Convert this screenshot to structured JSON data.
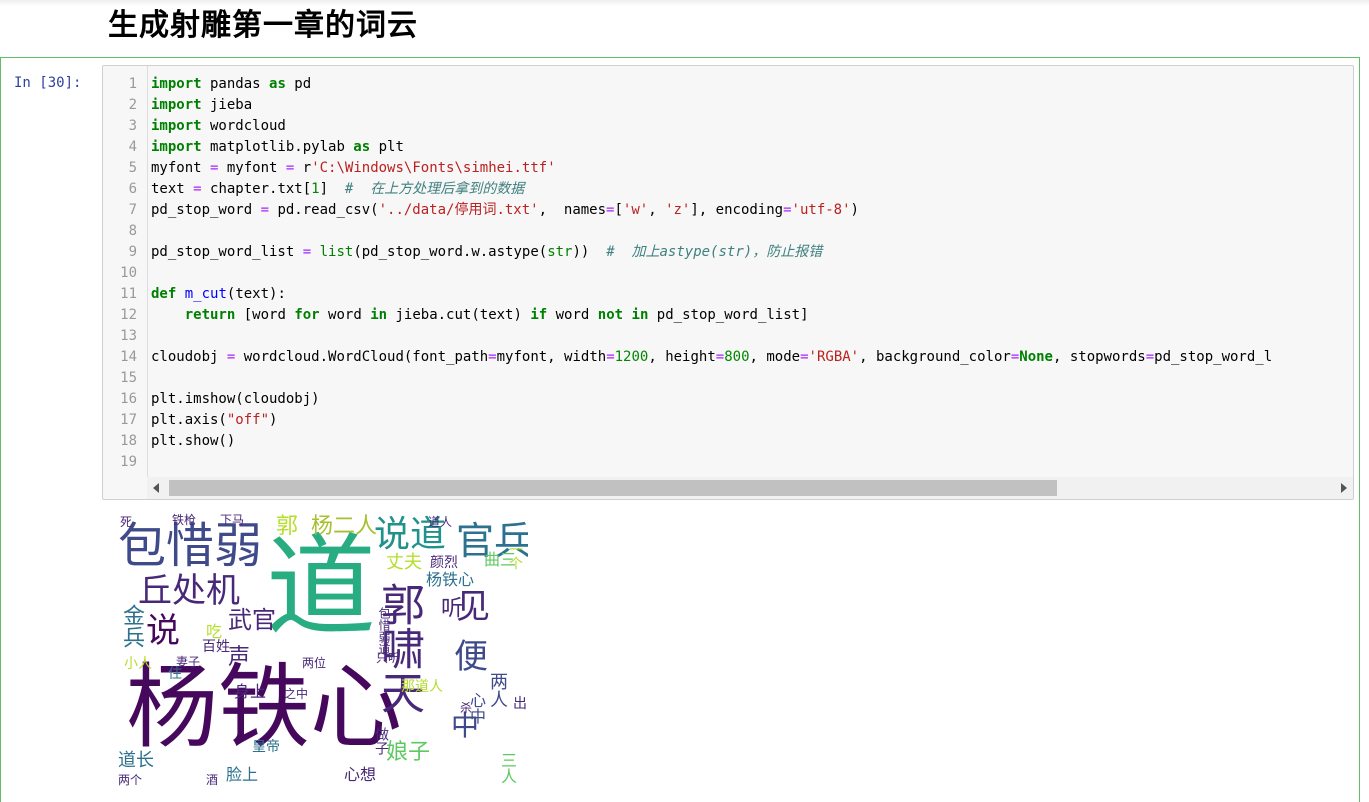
{
  "heading": "生成射雕第一章的词云",
  "cell": {
    "prompt": "In  [30]:",
    "line_numbers": [
      "1",
      "2",
      "3",
      "4",
      "5",
      "6",
      "7",
      "8",
      "9",
      "10",
      "11",
      "12",
      "13",
      "14",
      "15",
      "16",
      "17",
      "18",
      "19"
    ],
    "code_lines": [
      "import pandas as pd",
      "import jieba",
      "import wordcloud",
      "import matplotlib.pylab as plt",
      "myfont = myfont = r'C:\\Windows\\Fonts\\simhei.ttf'",
      "text = chapter.txt[1]  #  在上方处理后拿到的数据",
      "pd_stop_word = pd.read_csv('../data/停用词.txt',  names=['w', 'z'], encoding='utf-8')",
      "",
      "pd_stop_word_list = list(pd_stop_word.w.astype(str))  #  加上astype(str)，防止报错",
      "",
      "def m_cut(text):",
      "    return [word for word in jieba.cut(text) if word not in pd_stop_word_list]",
      "",
      "cloudobj = wordcloud.WordCloud(font_path=myfont, width=1200, height=800, mode='RGBA', background_color=None, stopwords=pd_stop_word_l",
      "",
      "plt.imshow(cloudobj)",
      "plt.axis(\"off\")",
      "plt.show()",
      ""
    ]
  },
  "wordcloud": {
    "colors": {
      "dark": "#46085c",
      "purple": "#482878",
      "blue": "#3e4a89",
      "teal": "#2c728e",
      "cyan": "#21918c",
      "green": "#27ad81",
      "lime": "#5ec962",
      "yellow": "#b5de2b",
      "olive": "#a8c030"
    },
    "words": [
      {
        "text": "杨铁心",
        "color": "dark"
      },
      {
        "text": "道",
        "color": "green"
      },
      {
        "text": "包惜弱",
        "color": "blue"
      },
      {
        "text": "郭啸天",
        "color": "purple"
      },
      {
        "text": "说道",
        "color": "cyan"
      },
      {
        "text": "官兵",
        "color": "teal"
      },
      {
        "text": "丘处机",
        "color": "purple"
      },
      {
        "text": "说",
        "color": "dark"
      },
      {
        "text": "武官",
        "color": "purple"
      },
      {
        "text": "见",
        "color": "purple"
      },
      {
        "text": "便",
        "color": "blue"
      },
      {
        "text": "听",
        "color": "purple"
      },
      {
        "text": "金兵",
        "color": "teal"
      },
      {
        "text": "杨二人",
        "color": "olive"
      },
      {
        "text": "郭",
        "color": "yellow"
      },
      {
        "text": "丈夫",
        "color": "yellow"
      },
      {
        "text": "娘子",
        "color": "lime"
      },
      {
        "text": "中",
        "color": "blue"
      },
      {
        "text": "两人",
        "color": "blue"
      },
      {
        "text": "杨铁心",
        "color": "teal"
      },
      {
        "text": "颜烈",
        "color": "purple"
      },
      {
        "text": "声",
        "color": "purple"
      },
      {
        "text": "身上",
        "color": "purple"
      },
      {
        "text": "吃",
        "color": "yellow"
      },
      {
        "text": "百姓",
        "color": "purple"
      },
      {
        "text": "心想",
        "color": "purple"
      },
      {
        "text": "道长",
        "color": "teal"
      },
      {
        "text": "小人",
        "color": "yellow"
      },
      {
        "text": "三人",
        "color": "lime"
      },
      {
        "text": "那道人",
        "color": "yellow"
      },
      {
        "text": "做子",
        "color": "purple"
      },
      {
        "text": "心中",
        "color": "blue"
      },
      {
        "text": "脸上",
        "color": "teal"
      },
      {
        "text": "皇帝",
        "color": "teal"
      },
      {
        "text": "两位",
        "color": "purple"
      },
      {
        "text": "出",
        "color": "purple"
      },
      {
        "text": "之中",
        "color": "purple"
      },
      {
        "text": "铁枪",
        "color": "purple"
      },
      {
        "text": "下马",
        "color": "purple"
      },
      {
        "text": "只听",
        "color": "purple"
      },
      {
        "text": "包惜弱道",
        "color": "purple"
      },
      {
        "text": "曲三",
        "color": "lime"
      },
      {
        "text": "一个",
        "color": "yellow"
      },
      {
        "text": "杀",
        "color": "purple"
      },
      {
        "text": "住",
        "color": "teal"
      },
      {
        "text": "妻子",
        "color": "purple"
      },
      {
        "text": "死",
        "color": "purple"
      },
      {
        "text": "道人",
        "color": "purple"
      },
      {
        "text": "两个",
        "color": "purple"
      },
      {
        "text": "酒",
        "color": "purple"
      }
    ]
  }
}
